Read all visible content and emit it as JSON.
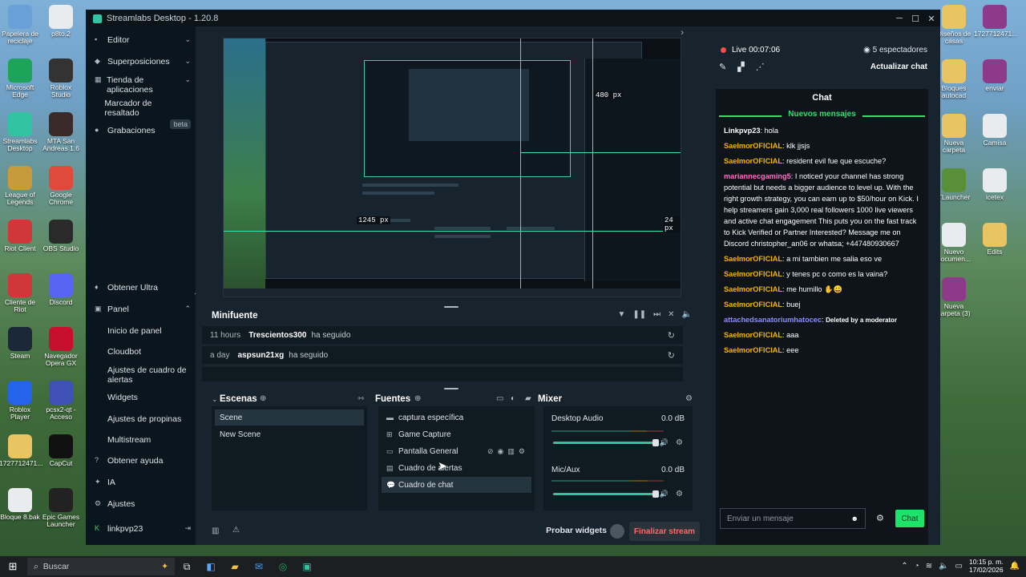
{
  "desktop": {
    "left_icons": [
      {
        "label": "Papelera de reciclaje",
        "name": "recycle-bin-icon",
        "color": "#6aa0d8"
      },
      {
        "label": "p8to.2",
        "name": "file-icon",
        "color": "#e9ecef"
      },
      {
        "label": "Microsoft Edge",
        "name": "edge-icon",
        "color": "#1ea35a"
      },
      {
        "label": "Roblox Studio",
        "name": "roblox-studio-icon",
        "color": "#333"
      },
      {
        "label": "Streamlabs Desktop",
        "name": "streamlabs-icon",
        "color": "#31c3a2"
      },
      {
        "label": "MTA San Andreas 1.6",
        "name": "mta-icon",
        "color": "#3a2a2a"
      },
      {
        "label": "League of Legends",
        "name": "league-icon",
        "color": "#c79b3b"
      },
      {
        "label": "Google Chrome",
        "name": "chrome-icon",
        "color": "#e04a3a"
      },
      {
        "label": "Riot Client",
        "name": "riot-client-icon",
        "color": "#d13639"
      },
      {
        "label": "OBS Studio",
        "name": "obs-icon",
        "color": "#2a2a2a"
      },
      {
        "label": "Cliente de Riot",
        "name": "riot-icon",
        "color": "#d13639"
      },
      {
        "label": "Discord",
        "name": "discord-icon",
        "color": "#5865f2"
      },
      {
        "label": "Steam",
        "name": "steam-icon",
        "color": "#1b2838"
      },
      {
        "label": "Navegador Opera GX",
        "name": "opera-gx-icon",
        "color": "#c8102e"
      },
      {
        "label": "Roblox Player",
        "name": "roblox-icon",
        "color": "#2563eb"
      },
      {
        "label": "pcsx2-qt - Acceso",
        "name": "pcsx2-icon",
        "color": "#3f51b5"
      },
      {
        "label": "1727712471...",
        "name": "folder-icon",
        "color": "#e8c463"
      },
      {
        "label": "CapCut",
        "name": "capcut-icon",
        "color": "#111"
      },
      {
        "label": "Bloque 8.bak",
        "name": "file-icon",
        "color": "#e9ecef"
      },
      {
        "label": "Epic Games Launcher",
        "name": "epic-icon",
        "color": "#222"
      }
    ],
    "right_icons": [
      {
        "label": "Diseños de casas",
        "name": "folder-icon",
        "color": "#e8c463"
      },
      {
        "label": "1727712471...",
        "name": "winrar-icon",
        "color": "#8e3a8a"
      },
      {
        "label": "Bloques autocad",
        "name": "folder-icon",
        "color": "#e8c463"
      },
      {
        "label": "enviar",
        "name": "winrar-icon",
        "color": "#8e3a8a"
      },
      {
        "label": "Nueva carpeta",
        "name": "folder-icon",
        "color": "#e8c463"
      },
      {
        "label": "Camisa",
        "name": "file-icon",
        "color": "#e9ecef"
      },
      {
        "label": "TLauncher",
        "name": "tlauncher-icon",
        "color": "#5a8f3a"
      },
      {
        "label": "icetex",
        "name": "file-icon",
        "color": "#e9ecef"
      },
      {
        "label": "Nuevo documen...",
        "name": "file-icon",
        "color": "#e9ecef"
      },
      {
        "label": "Edits",
        "name": "folder-icon",
        "color": "#e8c463"
      },
      {
        "label": "Nueva carpeta (3)",
        "name": "winrar-icon",
        "color": "#8e3a8a"
      }
    ]
  },
  "window": {
    "title": "Streamlabs Desktop - 1.20.8"
  },
  "sidebar": {
    "editor": "Editor",
    "overlays": "Superposiciones",
    "app_store": "Tienda de aplicaciones",
    "bookmark": "Marcador de resaltado",
    "beta": "beta",
    "recordings": "Grabaciones",
    "ultra": "Obtener Ultra",
    "panel": "Panel",
    "panel_items": [
      "Inicio de panel",
      "Cloudbot",
      "Ajustes de cuadro de alertas",
      "Widgets",
      "Ajustes de propinas",
      "Multistream"
    ],
    "help": "Obtener ayuda",
    "ai": "IA",
    "settings": "Ajustes",
    "user": "linkpvp23"
  },
  "preview": {
    "label_width": "480 px",
    "label_height": "1245 px",
    "label_side": "24 px"
  },
  "minifeed": {
    "title": "Minifuente",
    "events": [
      {
        "time": "11 hours",
        "user": "Trescientos300",
        "action": "ha seguido"
      },
      {
        "time": "a day",
        "user": "aspsun21xg",
        "action": "ha seguido"
      }
    ]
  },
  "scenes": {
    "title": "Escenas",
    "items": [
      "Scene",
      "New Scene"
    ]
  },
  "sources": {
    "title": "Fuentes",
    "items": [
      "captura específica",
      "Game Capture",
      "Pantalla General",
      "Cuadro de alertas",
      "Cuadro de chat"
    ]
  },
  "mixer": {
    "title": "Mixer",
    "channels": [
      {
        "name": "Desktop Audio",
        "db": "0.0 dB",
        "level": 1.0
      },
      {
        "name": "Mic/Aux",
        "db": "0.0 dB",
        "level": 1.0
      }
    ]
  },
  "footer": {
    "test_widgets": "Probar widgets",
    "end_stream": "Finalizar stream"
  },
  "stream": {
    "status": "Live",
    "time": "00:07:06",
    "viewers": "5 espectadores",
    "refresh": "Actualizar chat"
  },
  "chat": {
    "title": "Chat",
    "new_messages": "Nuevos mensajes",
    "messages": [
      {
        "user": "Linkpvp23",
        "text": "hola",
        "color": "#ffffff"
      },
      {
        "user": "SaelmorOFICIAL",
        "text": "klk jjsjs",
        "color": "#f5b400"
      },
      {
        "user": "SaelmorOFICIAL",
        "text": "resident evil fue que escuche?",
        "color": "#f5b400"
      },
      {
        "user": "mariannecgaming5",
        "text": "I noticed your channel has strong potential but needs a bigger audience to level up. With the right growth strategy, you can earn up to $50/hour on Kick. I help streamers gain 3,000 real followers 1000 live viewers and active chat engagement This puts you on the fast track to Kick Verified or Partner Interested? Message me on Discord christopher_an06 or whatsa; +447480930667",
        "color": "#ff6ec7"
      },
      {
        "user": "SaelmorOFICIAL",
        "text": "a mi tambien me salia eso ve",
        "color": "#f5b400"
      },
      {
        "user": "SaelmorOFICIAL",
        "text": "y tenes pc o como es la vaina?",
        "color": "#f5b400"
      },
      {
        "user": "SaelmorOFICIAL",
        "text": "me humillo ✋😀",
        "color": "#f5b400"
      },
      {
        "user": "SaelmorOFICIAL",
        "text": "buej",
        "color": "#f5b400"
      },
      {
        "user": "attachedsanatoriumhatocec",
        "text": "Deleted by a moderator",
        "color": "#8c8cff"
      },
      {
        "user": "SaelmorOFICIAL",
        "text": "aaa",
        "color": "#f5b400"
      },
      {
        "user": "SaelmorOFICIAL",
        "text": "eee",
        "color": "#f5b400"
      }
    ],
    "input_placeholder": "Enviar un mensaje",
    "send": "Chat"
  },
  "taskbar": {
    "search": "Buscar",
    "time": "10:15 p. m.",
    "date": "17/02/2026"
  }
}
